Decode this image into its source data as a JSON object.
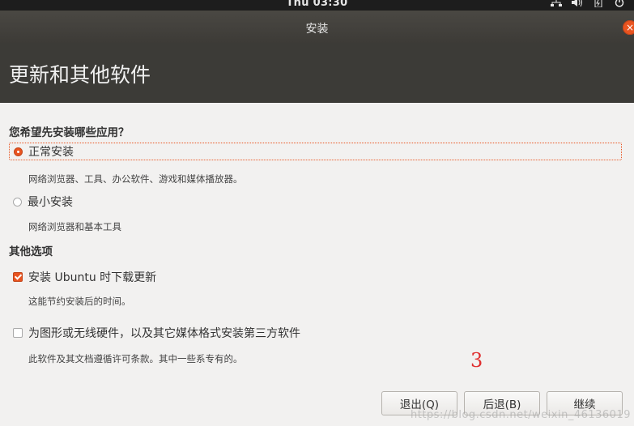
{
  "topbar": {
    "clock": "Thu 03:30",
    "icons": [
      "network-icon",
      "volume-icon",
      "battery-icon",
      "power-menu-icon"
    ]
  },
  "window": {
    "title": "安装",
    "close_label": "×"
  },
  "header": {
    "title": "更新和其他软件"
  },
  "question": "您希望先安装哪些应用？",
  "options": {
    "normal": {
      "label": "正常安装",
      "desc": "网络浏览器、工具、办公软件、游戏和媒体播放器。",
      "selected": true
    },
    "minimal": {
      "label": "最小安装",
      "desc": "网络浏览器和基本工具",
      "selected": false
    }
  },
  "other_section": "其他选项",
  "checks": {
    "updates": {
      "label": "安装 Ubuntu 时下载更新",
      "desc": "这能节约安装后的时间。",
      "checked": true
    },
    "third_party": {
      "label": "为图形或无线硬件，以及其它媒体格式安装第三方软件",
      "desc": "此软件及其文档遵循许可条款。其中一些系专有的。",
      "checked": false
    }
  },
  "annotation": "3",
  "buttons": {
    "quit": "退出(Q)",
    "back": "后退(B)",
    "continue": "继续"
  },
  "watermark": "https://blog.csdn.net/weixin_46136019",
  "colors": {
    "accent": "#e95420",
    "header_bg": "#3c3b37",
    "body_bg": "#f2f1f0"
  }
}
